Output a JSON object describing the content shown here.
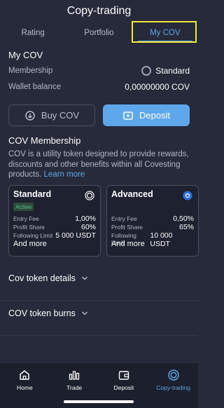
{
  "header": {
    "title": "Copy-trading"
  },
  "tabs": [
    {
      "label": "Rating"
    },
    {
      "label": "Portfolio"
    },
    {
      "label": "My COV"
    }
  ],
  "my_cov": {
    "title": "My COV",
    "membership_label": "Membership",
    "membership_value": "Standard",
    "wallet_label": "Wallet balance",
    "wallet_value": "0,00000000 COV"
  },
  "actions": {
    "buy_label": "Buy COV",
    "deposit_label": "Deposit"
  },
  "membership": {
    "title": "COV Membership",
    "description": "COV is a utility token designed to provide rewards, discounts and other benefits within all Covesting products.",
    "learn_more": "Learn more",
    "cards": [
      {
        "name": "Standard",
        "badge": "Active",
        "entry_fee_label": "Entry Fee",
        "entry_fee": "1,00%",
        "profit_share_label": "Profit Share",
        "profit_share": "60%",
        "following_limit_label": "Following Limit",
        "following_limit": "5 000 USDT",
        "more": "And more"
      },
      {
        "name": "Advanced",
        "entry_fee_label": "Entry Fee",
        "entry_fee": "0,50%",
        "profit_share_label": "Profit Share",
        "profit_share": "65%",
        "following_limit_label": "Following Limit",
        "following_limit": "10 000 USDT",
        "more": "And more"
      }
    ]
  },
  "sections": {
    "token_details": "Cov token details",
    "token_burns": "COV token burns"
  },
  "nav": [
    {
      "label": "Home",
      "icon": "home-icon"
    },
    {
      "label": "Trade",
      "icon": "bar-chart-icon"
    },
    {
      "label": "Deposit",
      "icon": "wallet-icon"
    },
    {
      "label": "Copy-trading",
      "icon": "copy-trading-icon"
    }
  ],
  "colors": {
    "accent": "#5ea7ea",
    "background": "#272a3a",
    "active_badge": "#4cc38a",
    "highlight": "#f2e93a"
  }
}
